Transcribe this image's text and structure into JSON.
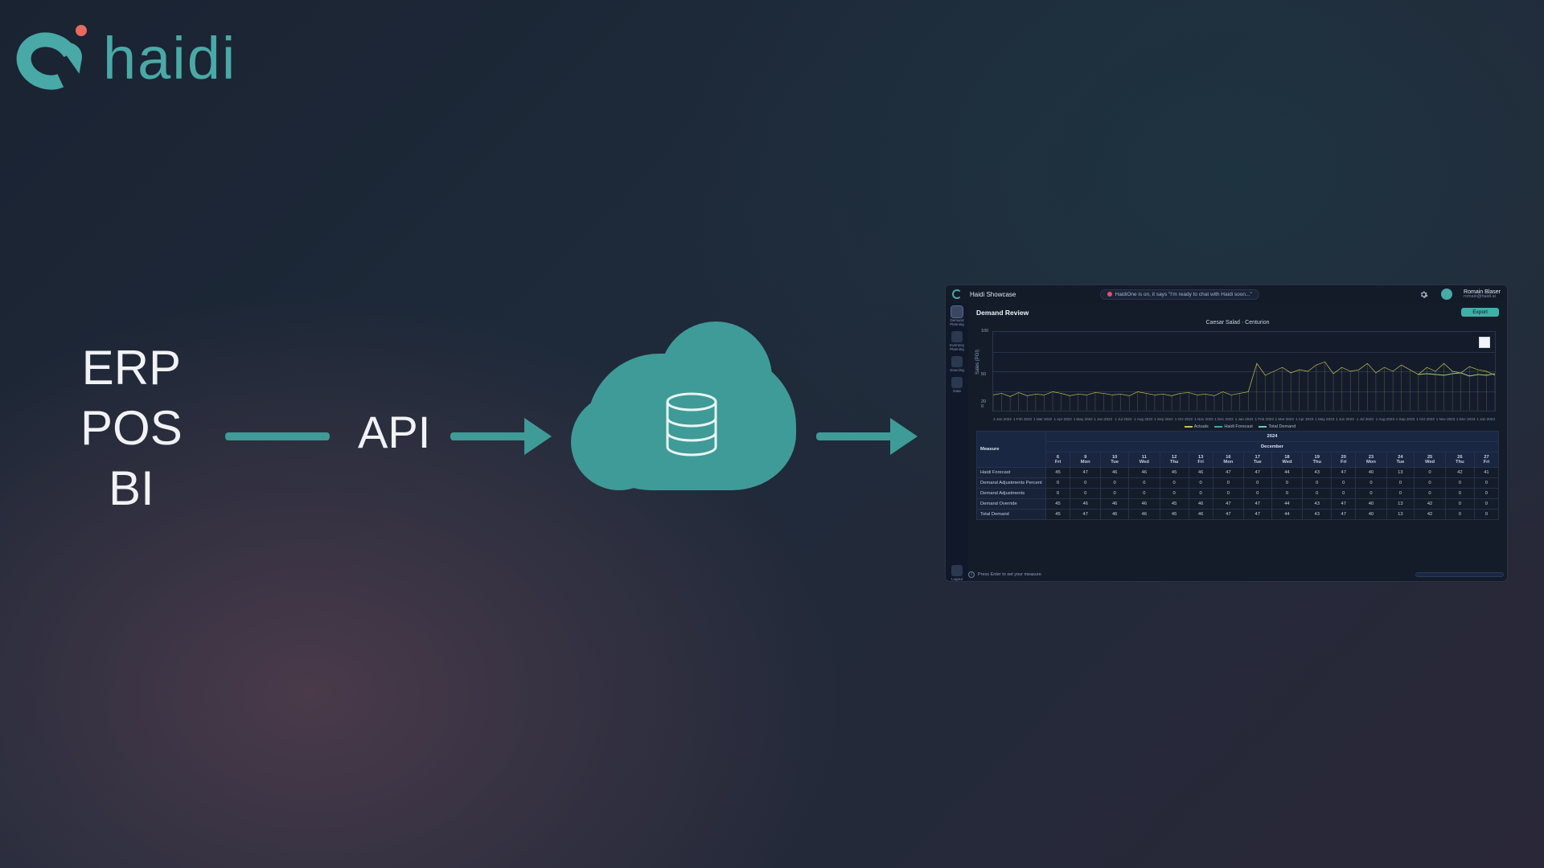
{
  "brand": {
    "name": "haidi"
  },
  "sources": [
    "ERP",
    "POS",
    "BI"
  ],
  "api_label": "API",
  "colors": {
    "accent": "#3f9b97",
    "accent_text": "#48a9a6",
    "dot": "#e86a5e"
  },
  "dashboard": {
    "title": "Haidi Showcase",
    "search_placeholder": "HaidiOne is on, it says \"I'm ready to chat with Haidi soon...\"",
    "page_title": "Demand Review",
    "export_label": "Export",
    "user": {
      "name": "Romain Blaser",
      "email": "romain@haidi.ai"
    },
    "side_items": [
      "Demand Planning",
      "Inventory Planning",
      "Sourcing",
      "Data"
    ],
    "logout_label": "Logout",
    "chart_title": "Caesar Salad · Centurion",
    "y_label": "Sales (PGI)",
    "legend": {
      "a": "Actuals",
      "b": "Haidi Forecast",
      "c": "Total Demand"
    },
    "table": {
      "year": "2024",
      "month": "December",
      "measure_label": "Measure",
      "days": [
        "6",
        "9",
        "10",
        "11",
        "12",
        "13",
        "16",
        "17",
        "18",
        "19",
        "20",
        "23",
        "24",
        "25",
        "26",
        "27"
      ],
      "weekdays": [
        "Fri",
        "Mon",
        "Tue",
        "Wed",
        "Thu",
        "Fri",
        "Mon",
        "Tue",
        "Wed",
        "Thu",
        "Fri",
        "Mon",
        "Tue",
        "Wed",
        "Thu",
        "Fri"
      ],
      "rows": [
        {
          "label": "Haidi Forecast",
          "v": [
            45,
            47,
            46,
            46,
            45,
            46,
            47,
            47,
            44,
            43,
            47,
            40,
            13,
            0,
            42,
            41
          ]
        },
        {
          "label": "Demand Adjustments Percent",
          "v": [
            0,
            0,
            0,
            0,
            0,
            0,
            0,
            0,
            0,
            0,
            0,
            0,
            0,
            0,
            0,
            0
          ]
        },
        {
          "label": "Demand Adjustments",
          "v": [
            0,
            0,
            0,
            0,
            0,
            0,
            0,
            0,
            0,
            0,
            0,
            0,
            0,
            0,
            0,
            0
          ]
        },
        {
          "label": "Demand Override",
          "v": [
            45,
            46,
            46,
            46,
            45,
            46,
            47,
            47,
            44,
            43,
            47,
            40,
            13,
            42,
            0,
            0
          ]
        },
        {
          "label": "Total Demand",
          "v": [
            45,
            47,
            46,
            46,
            45,
            46,
            47,
            47,
            44,
            43,
            47,
            40,
            13,
            42,
            0,
            0
          ]
        }
      ]
    },
    "footer_hint": "Press Enter to set your measure"
  },
  "chart_data": {
    "type": "line",
    "title": "Caesar Salad · Centurion",
    "ylabel": "Sales (PGI)",
    "xlabel": "",
    "ylim": [
      0,
      100
    ],
    "yticks": [
      0,
      20,
      50,
      100
    ],
    "x_ticks": [
      "4 Jan 2022",
      "1 Feb 2022",
      "1 Mar 2022",
      "1 Apr 2022",
      "1 May 2022",
      "1 Jun 2022",
      "1 Jul 2022",
      "1 Aug 2022",
      "1 Sep 2022",
      "1 Oct 2022",
      "1 Nov 2022",
      "1 Dec 2022",
      "1 Jan 2023",
      "1 Feb 2023",
      "1 Mar 2023",
      "1 Apr 2023",
      "1 May 2023",
      "1 Jun 2023",
      "1 Jul 2023",
      "1 Aug 2023",
      "1 Sep 2023",
      "1 Oct 2023",
      "1 Nov 2023",
      "1 Dec 2023",
      "1 Jan 2024"
    ],
    "series": [
      {
        "name": "Actuals",
        "color": "#c9c04a",
        "values": [
          20,
          22,
          18,
          23,
          19,
          21,
          20,
          24,
          22,
          19,
          21,
          20,
          23,
          22,
          20,
          21,
          19,
          24,
          22,
          20,
          21,
          19,
          22,
          23,
          20,
          21,
          19,
          24,
          20,
          22,
          24,
          60,
          45,
          50,
          55,
          48,
          52,
          50,
          58,
          62,
          47,
          55,
          50,
          52,
          60,
          48,
          55,
          50,
          58,
          52,
          46,
          55,
          50,
          60,
          50,
          48,
          56,
          52,
          50,
          45
        ]
      },
      {
        "name": "Haidi Forecast",
        "color": "#3fa6a0",
        "values": [
          null,
          null,
          null,
          null,
          null,
          null,
          null,
          null,
          null,
          null,
          null,
          null,
          null,
          null,
          null,
          null,
          null,
          null,
          null,
          null,
          null,
          null,
          null,
          null,
          null,
          null,
          null,
          null,
          null,
          null,
          null,
          null,
          null,
          null,
          null,
          null,
          null,
          null,
          null,
          null,
          null,
          null,
          null,
          null,
          null,
          null,
          null,
          null,
          null,
          null,
          46,
          47,
          46,
          45,
          47,
          48,
          44,
          46,
          45,
          47
        ]
      },
      {
        "name": "Total Demand",
        "color": "#6ec7c2",
        "values": [
          null,
          null,
          null,
          null,
          null,
          null,
          null,
          null,
          null,
          null,
          null,
          null,
          null,
          null,
          null,
          null,
          null,
          null,
          null,
          null,
          null,
          null,
          null,
          null,
          null,
          null,
          null,
          null,
          null,
          null,
          null,
          null,
          null,
          null,
          null,
          null,
          null,
          null,
          null,
          null,
          null,
          null,
          null,
          null,
          null,
          null,
          null,
          null,
          null,
          null,
          46,
          47,
          46,
          45,
          47,
          48,
          44,
          46,
          45,
          47
        ]
      }
    ]
  }
}
